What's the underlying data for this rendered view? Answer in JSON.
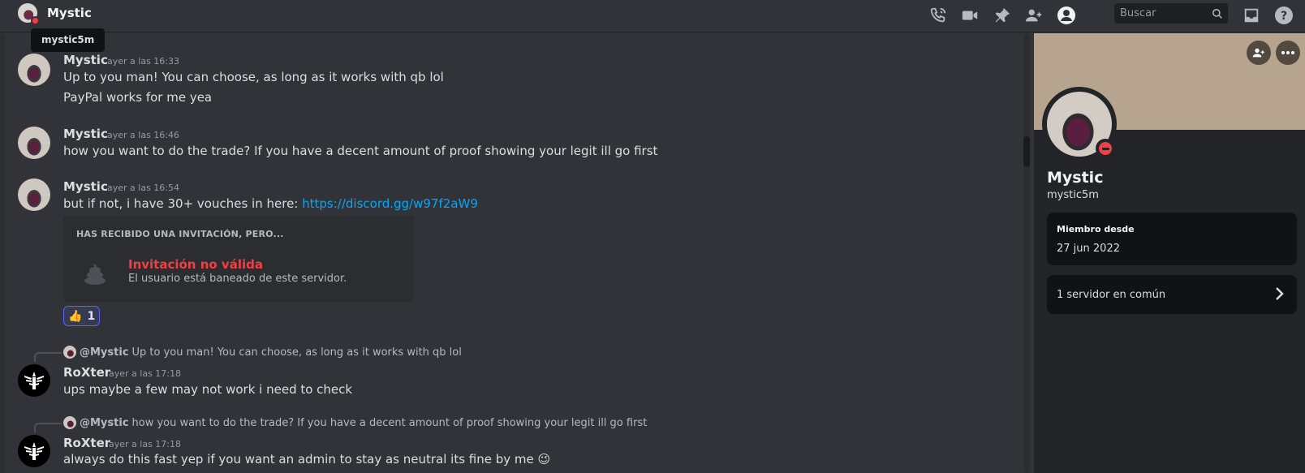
{
  "header": {
    "title": "Mystic",
    "tooltip": "mystic5m",
    "search_placeholder": "Buscar",
    "icons": [
      "phone-call-icon",
      "video-icon",
      "pin-icon",
      "add-friends-icon",
      "profile-icon",
      "search-icon",
      "inbox-icon",
      "help-icon"
    ]
  },
  "messages": [
    {
      "author": "Mystic",
      "time": "ayer a las 16:33",
      "lines": [
        "Up to you man! You can choose, as long as it works with qb lol",
        "PayPal works for me yea"
      ]
    },
    {
      "author": "Mystic",
      "time": "ayer a las 16:46",
      "lines": [
        "how you want to do the trade? If you have a decent amount of proof showing your legit ill go first"
      ]
    },
    {
      "author": "Mystic",
      "time": "ayer a las 16:54",
      "text": "but if not, i have 30+ vouches in here: ",
      "link": "https://discord.gg/w97f2aW9"
    },
    {
      "author": "RoXter",
      "time": "ayer a las 17:18",
      "reply_to": "@Mystic",
      "reply_text": "Up to you man! You can choose, as long as it works with qb lol",
      "lines": [
        "ups maybe a few may not work i need to check"
      ]
    },
    {
      "author": "RoXter",
      "time": "ayer a las 17:18",
      "reply_to": "@Mystic",
      "reply_text": "how you want to do the trade? If you have a decent amount of proof showing your legit ill go first",
      "lines": [
        "always do this fast yep if you want an admin to stay as neutral its fine by me"
      ]
    }
  ],
  "invite": {
    "heading": "HAS RECIBIDO UNA INVITACIÓN, PERO...",
    "title": "Invitación no válida",
    "subtitle": "El usuario está baneado de este servidor."
  },
  "reaction": {
    "emoji": "👍",
    "count": "1"
  },
  "profile": {
    "display_name": "Mystic",
    "username": "mystic5m",
    "member_since_label": "Miembro desde",
    "member_since_value": "27 jun 2022",
    "mutual_servers": "1 servidor en común"
  },
  "colors": {
    "link": "#00a8fc",
    "dnd": "#f23f43",
    "banner": "#b6a48f",
    "accent": "#5865f2"
  }
}
